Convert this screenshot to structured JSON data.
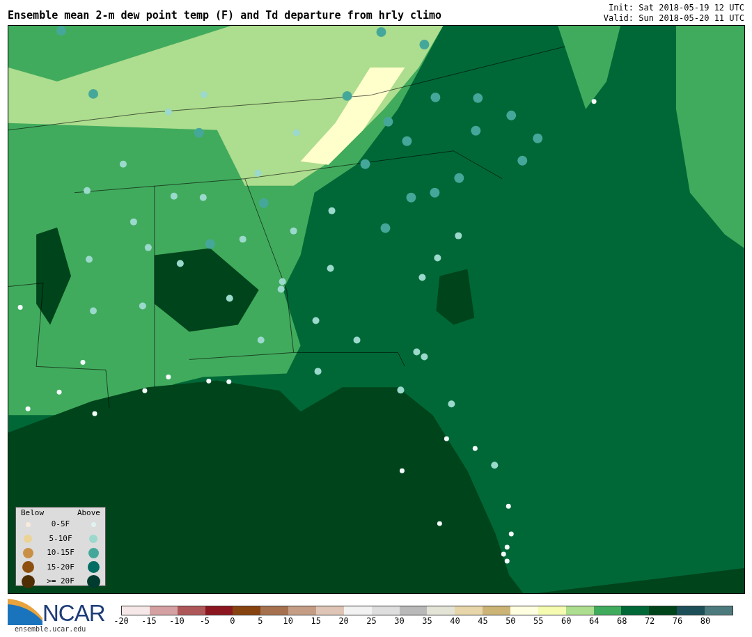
{
  "title": "Ensemble mean 2-m dew point temp (F) and Td departure from hrly climo",
  "init": "Init: Sat 2018-05-19 12 UTC",
  "valid": "Valid: Sun 2018-05-20 11 UTC",
  "legend": {
    "below_heading": "Below",
    "above_heading": "Above",
    "rows": [
      {
        "label": "0-5F",
        "below": {
          "color": "#f9eadb"
        },
        "above": {
          "color": "#e0f3f0"
        }
      },
      {
        "label": "5-10F",
        "below": {
          "color": "#ebd396"
        },
        "above": {
          "color": "#9ad9cc"
        }
      },
      {
        "label": "10-15F",
        "below": {
          "color": "#c98f45"
        },
        "above": {
          "color": "#45a79a"
        }
      },
      {
        "label": "15-20F",
        "below": {
          "color": "#8e500e"
        },
        "above": {
          "color": "#016c62"
        }
      },
      {
        "label": ">= 20F",
        "below": {
          "color": "#4f2e04"
        },
        "above": {
          "color": "#003b30"
        }
      }
    ]
  },
  "logo": {
    "text": "NCAR",
    "url": "ensemble.ucar.edu"
  },
  "colorbar": {
    "segments": [
      {
        "color": "#f6e8e8"
      },
      {
        "color": "#d4a0a2"
      },
      {
        "color": "#ae5758"
      },
      {
        "color": "#8c1620"
      },
      {
        "color": "#86420f"
      },
      {
        "color": "#a5714f"
      },
      {
        "color": "#c49d84"
      },
      {
        "color": "#dfc5b5"
      },
      {
        "color": "#f2f2f2"
      },
      {
        "color": "#dedede"
      },
      {
        "color": "#b9b9b9"
      },
      {
        "color": "#e3e3d6"
      },
      {
        "color": "#e6d6a9"
      },
      {
        "color": "#cbb476"
      },
      {
        "color": "#fefee0"
      },
      {
        "color": "#f5fbb0"
      },
      {
        "color": "#addd8e"
      },
      {
        "color": "#41ab5d"
      },
      {
        "color": "#006837"
      },
      {
        "color": "#00441b"
      },
      {
        "color": "#1c4f57"
      },
      {
        "color": "#4d7a7c"
      }
    ],
    "ticks": [
      "-20",
      "-15",
      "-10",
      "-5",
      "0",
      "5",
      "10",
      "15",
      "20",
      "25",
      "30",
      "35",
      "40",
      "45",
      "50",
      "55",
      "60",
      "64",
      "68",
      "72",
      "76",
      "80"
    ]
  }
}
